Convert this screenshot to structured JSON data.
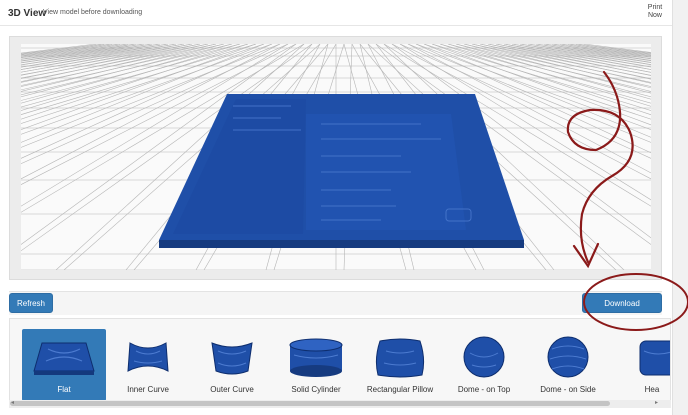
{
  "header": {
    "title": "3D View",
    "subtitle": "View model before downloading",
    "print_line1": "Print",
    "print_line2": "Now"
  },
  "toolbar": {
    "refresh_label": "Refresh",
    "download_label": "Download"
  },
  "shapes": [
    {
      "label": "Flat",
      "selected": true
    },
    {
      "label": "Inner Curve"
    },
    {
      "label": "Outer Curve"
    },
    {
      "label": "Solid Cylinder"
    },
    {
      "label": "Rectangular Pillow"
    },
    {
      "label": "Dome - on Top"
    },
    {
      "label": "Dome - on Side"
    },
    {
      "label": "Hea"
    }
  ],
  "colors": {
    "accent": "#337ab7",
    "model": "#1f4fa8",
    "annotation": "#8b1a1a"
  }
}
